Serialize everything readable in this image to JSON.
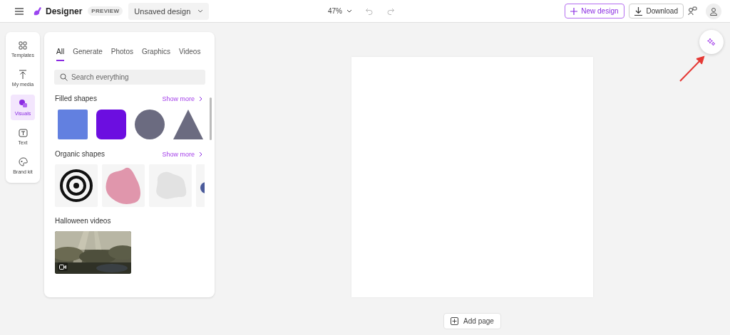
{
  "header": {
    "app_name": "Designer",
    "badge": "PREVIEW",
    "document_title": "Unsaved design",
    "zoom": "47%",
    "new_design": "New design",
    "download": "Download"
  },
  "rail": [
    {
      "label": "Templates",
      "kind": "templates",
      "selected": false
    },
    {
      "label": "My media",
      "kind": "media",
      "selected": false
    },
    {
      "label": "Visuals",
      "kind": "visuals",
      "selected": true
    },
    {
      "label": "Text",
      "kind": "text",
      "selected": false
    },
    {
      "label": "Brand kit",
      "kind": "brand",
      "selected": false
    }
  ],
  "tabs": [
    {
      "label": "All",
      "selected": true
    },
    {
      "label": "Generate",
      "selected": false
    },
    {
      "label": "Photos",
      "selected": false
    },
    {
      "label": "Graphics",
      "selected": false
    },
    {
      "label": "Videos",
      "selected": false
    }
  ],
  "search": {
    "placeholder": "Search everything"
  },
  "sections": [
    {
      "title": "Filled shapes",
      "show_more": "Show more",
      "kind": "filled",
      "items": [
        {
          "kind": "square",
          "color": "#6280e0"
        },
        {
          "kind": "rounded",
          "color": "#6c0ee0"
        },
        {
          "kind": "circle",
          "color": "#6b6b80"
        },
        {
          "kind": "triangle",
          "color": "#6b6b80"
        }
      ]
    },
    {
      "title": "Organic shapes",
      "show_more": "Show more",
      "kind": "organic",
      "items": [
        {
          "kind": "target",
          "color": "#111111"
        },
        {
          "kind": "blob",
          "color": "#e096ac"
        },
        {
          "kind": "cloud",
          "color": "#e2e2e2"
        },
        {
          "kind": "dot",
          "color": "#4a5a9a"
        }
      ]
    },
    {
      "title": "Halloween videos",
      "kind": "videos"
    }
  ],
  "canvas": {
    "add_page": "Add page"
  }
}
